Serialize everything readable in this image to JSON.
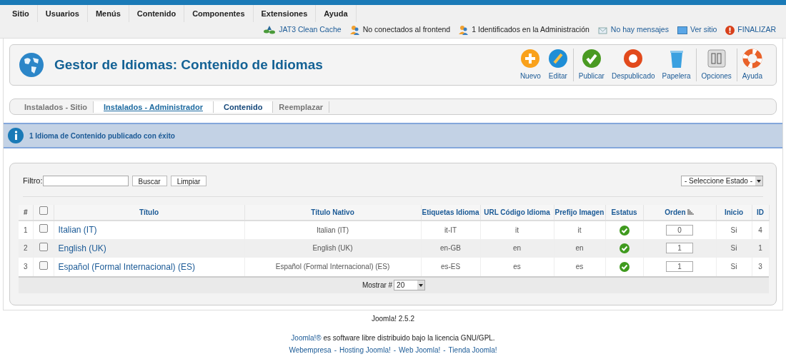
{
  "menu": [
    "Sitio",
    "Usuarios",
    "Menús",
    "Contenido",
    "Componentes",
    "Extensiones",
    "Ayuda"
  ],
  "status_links": [
    {
      "kind": "cache",
      "text": "JAT3 Clean Cache"
    },
    {
      "kind": "users",
      "text": "No conectados al frontend"
    },
    {
      "kind": "users",
      "text": "1 Identificados en la Administración"
    },
    {
      "kind": "mail",
      "text": "No hay mensajes"
    },
    {
      "kind": "screen",
      "text": "Ver sitio"
    },
    {
      "kind": "logout",
      "text": "FINALIZAR"
    }
  ],
  "header": {
    "title": "Gestor de Idiomas: Contenido de Idiomas"
  },
  "toolbar": [
    [
      {
        "kind": "new",
        "label": "Nuevo"
      },
      {
        "kind": "edit",
        "label": "Editar"
      }
    ],
    [
      {
        "kind": "publish",
        "label": "Publicar"
      },
      {
        "kind": "unpublish",
        "label": "Despublicado"
      },
      {
        "kind": "trash",
        "label": "Papelera"
      }
    ],
    [
      {
        "kind": "options",
        "label": "Opciones"
      }
    ],
    [
      {
        "kind": "help",
        "label": "Ayuda"
      }
    ]
  ],
  "submenu": [
    {
      "label": "Instalados - Sitio",
      "selected": false,
      "hovered": false
    },
    {
      "label": "Instalados - Administrador",
      "selected": false,
      "hovered": true
    },
    {
      "label": "Contenido",
      "selected": true,
      "hovered": false
    },
    {
      "label": "Reemplazar",
      "selected": false,
      "hovered": false
    }
  ],
  "message": "1 Idioma de Contenido publicado con éxito",
  "filter": {
    "label": "Filtro:",
    "buttons": [
      "Buscar",
      "Limpiar"
    ],
    "state_select": "- Seleccione Estado -"
  },
  "table": {
    "columns": [
      {
        "kind": "text",
        "label": "#"
      },
      {
        "kind": "checkbox",
        "checked": false
      },
      {
        "kind": "text",
        "label": "Título"
      },
      {
        "kind": "text",
        "label": "Título Nativo"
      },
      {
        "kind": "text",
        "label": "Etiquetas Idioma"
      },
      {
        "kind": "text",
        "label": "URL Código Idioma"
      },
      {
        "kind": "text",
        "label": "Prefijo Imagen"
      },
      {
        "kind": "text",
        "label": "Estatus"
      },
      {
        "kind": "sort",
        "label": "Orden"
      },
      {
        "kind": "text",
        "label": "Inicio"
      },
      {
        "kind": "text",
        "label": "ID"
      }
    ],
    "rows": [
      {
        "num": "1",
        "checked": false,
        "title": "Italian (IT)",
        "native": "Italian (IT)",
        "tag": "it-IT",
        "url_code": "it",
        "prefix": "it",
        "published": true,
        "order": "0",
        "home": "Si",
        "id": "4"
      },
      {
        "num": "2",
        "checked": false,
        "title": "English (UK)",
        "native": "English (UK)",
        "tag": "en-GB",
        "url_code": "en",
        "prefix": "en",
        "published": true,
        "order": "1",
        "home": "Si",
        "id": "1"
      },
      {
        "num": "3",
        "checked": false,
        "title": "Español (Formal Internacional) (ES)",
        "native": "Español (Formal Internacional) (ES)",
        "tag": "es-ES",
        "url_code": "es",
        "prefix": "es",
        "published": true,
        "order": "1",
        "home": "Si",
        "id": "3"
      }
    ]
  },
  "pagination": {
    "label": "Mostrar #",
    "value": "20"
  },
  "footer": {
    "version": "Joomla! 2.5.2",
    "license_link": "Joomla!®",
    "license_text": " es software libre distribuido bajo la licencia GNU/GPL.",
    "separator": "-",
    "links": [
      "Webempresa",
      "Hosting Joomla!",
      "Web Joomla!",
      "Tienda Joomla!"
    ]
  }
}
